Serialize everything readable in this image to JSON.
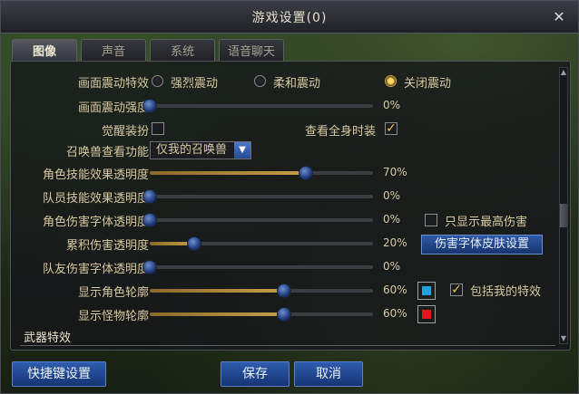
{
  "window": {
    "title": "游戏设置(0)",
    "close_glyph": "✕"
  },
  "tabs": [
    {
      "label": "图像",
      "active": true
    },
    {
      "label": "声音",
      "active": false
    },
    {
      "label": "系统",
      "active": false
    },
    {
      "label": "语音聊天",
      "active": false
    }
  ],
  "screen_shake": {
    "label": "画面震动特效",
    "options": [
      {
        "label": "强烈震动",
        "selected": false
      },
      {
        "label": "柔和震动",
        "selected": false
      },
      {
        "label": "关闭震动",
        "selected": true
      }
    ]
  },
  "shake_strength": {
    "label": "画面震动强度",
    "value": 0,
    "value_text": "0%"
  },
  "awaken_outfit": {
    "label": "觉醒装扮",
    "checked": false
  },
  "view_full_outfit": {
    "label": "查看全身时装",
    "checked": true
  },
  "summon_view": {
    "label": "召唤兽查看功能",
    "selected": "仅我的召唤兽"
  },
  "sliders": [
    {
      "key": "skill_effect_opacity",
      "label": "角色技能效果透明度",
      "value": 70,
      "value_text": "70%"
    },
    {
      "key": "team_skill_opacity",
      "label": "队员技能效果透明度",
      "value": 0,
      "value_text": "0%"
    },
    {
      "key": "damage_font_opacity",
      "label": "角色伤害字体透明度",
      "value": 0,
      "value_text": "0%"
    },
    {
      "key": "cumulative_damage_opacity",
      "label": "累积伤害透明度",
      "value": 20,
      "value_text": "20%"
    },
    {
      "key": "teammate_damage_font_opacity",
      "label": "队友伤害字体透明度",
      "value": 0,
      "value_text": "0%"
    },
    {
      "key": "character_outline",
      "label": "显示角色轮廓",
      "value": 60,
      "value_text": "60%"
    },
    {
      "key": "monster_outline",
      "label": "显示怪物轮廓",
      "value": 60,
      "value_text": "60%"
    }
  ],
  "show_max_damage": {
    "label": "只显示最高伤害",
    "checked": false
  },
  "damage_font_skin_button": "伤害字体皮肤设置",
  "character_outline_color": "#1fa3e0",
  "monster_outline_color": "#e01a1a",
  "include_my_effects": {
    "label": "包括我的特效",
    "checked": true
  },
  "weapon_section": "武器特效",
  "footer": {
    "shortcut_label": "快捷键设置",
    "save_label": "保存",
    "cancel_label": "取消"
  },
  "colors": {
    "accent_gold": "#c79d4a",
    "knob_blue": "#2f5aa8"
  }
}
